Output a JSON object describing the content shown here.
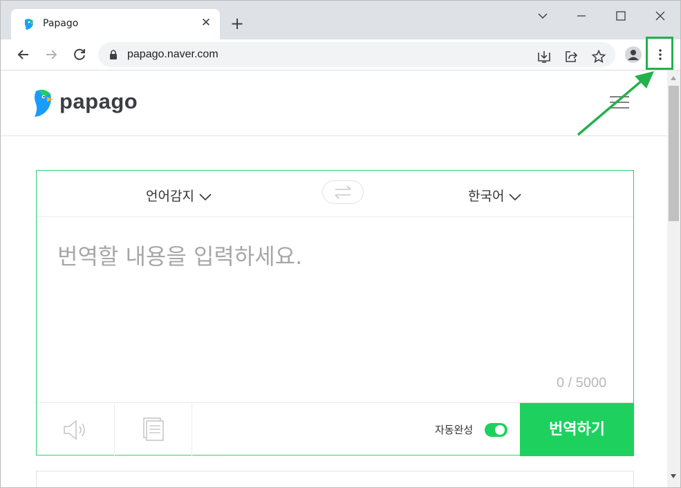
{
  "browser": {
    "tab_title": "Papago",
    "url": "papago.naver.com"
  },
  "site": {
    "logo_text": "papago"
  },
  "translator": {
    "source_language": "언어감지",
    "target_language": "한국어",
    "placeholder": "번역할 내용을 입력하세요.",
    "char_counter": "0 / 5000",
    "autocomplete_label": "자동완성",
    "autocomplete_on": true,
    "translate_button": "번역하기"
  },
  "icons": {
    "favicon": "papago-parrot-icon",
    "tab_close": "close-icon",
    "new_tab": "plus-icon",
    "back": "arrow-left-icon",
    "forward": "arrow-right-icon",
    "reload": "reload-icon",
    "lock": "lock-icon",
    "install": "install-app-icon",
    "share": "share-icon",
    "bookmark": "star-icon",
    "profile": "profile-icon",
    "menu": "more-vertical-icon",
    "hamburger": "hamburger-menu-icon",
    "swap": "swap-icon",
    "tts": "speaker-icon",
    "copy": "copy-icon"
  },
  "colors": {
    "accent_green": "#1ed15f",
    "annotation_green": "#23b14d"
  }
}
